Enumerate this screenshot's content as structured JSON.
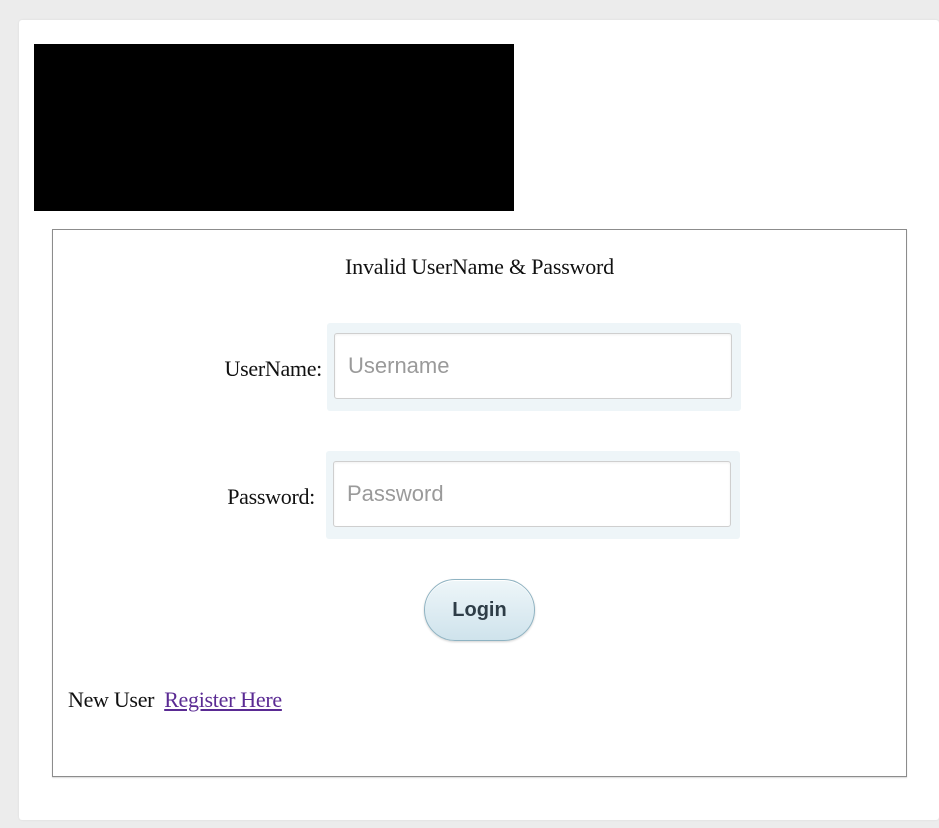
{
  "login_form": {
    "message": "Invalid UserName & Password",
    "username_label": "UserName:",
    "username_placeholder": "Username",
    "username_value": "",
    "password_label": "Password:",
    "password_placeholder": "Password",
    "password_value": "",
    "login_button_label": "Login"
  },
  "register": {
    "prompt": "New User",
    "link_text": "Register Here"
  },
  "colors": {
    "page_background": "#ececec",
    "link": "#5a2a93",
    "button_gradient_top": "#eef6f9",
    "button_gradient_bottom": "#cfe3ec"
  }
}
